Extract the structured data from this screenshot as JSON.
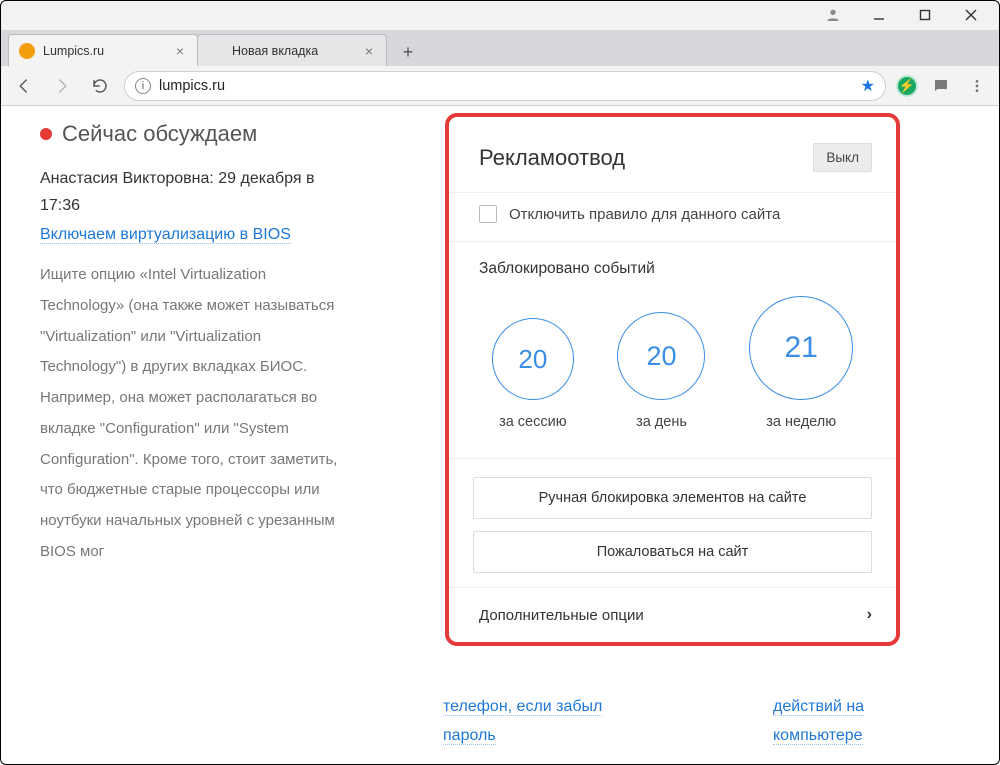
{
  "titlebar": {},
  "tabs": [
    {
      "title": "Lumpics.ru",
      "active": true
    },
    {
      "title": "Новая вкладка",
      "active": false
    }
  ],
  "address": {
    "url": "lumpics.ru"
  },
  "sidebar": {
    "heading": "Сейчас обсуждаем",
    "author_line": "Анастасия Викторовна: 29 декабря в 17:36",
    "link_text": "Включаем виртуализацию в BIOS",
    "body": "Ищите опцию «Intel Virtualization Technology» (она также может называться \"Virtualization\" или \"Virtualization Technology\") в других вкладках БИОС. Например, она может располагаться во вкладке \"Configuration\" или \"System Configuration\". Кроме того, стоит заметить, что бюджетные старые процессоры или ноутбуки начальных уровней с урезанным BIOS мог"
  },
  "bg": {
    "left_line1": "телефон, если забыл",
    "left_line2": "пароль",
    "right_line1": "действий на",
    "right_line2": "компьютере"
  },
  "popup": {
    "title": "Рекламоотвод",
    "off_button": "Выкл",
    "disable_rule": "Отключить правило для данного сайта",
    "blocked_title": "Заблокировано событий",
    "stats": [
      {
        "value": "20",
        "label": "за сессию"
      },
      {
        "value": "20",
        "label": "за день"
      },
      {
        "value": "21",
        "label": "за неделю"
      }
    ],
    "manual_block": "Ручная блокировка элементов на сайте",
    "report": "Пожаловаться на сайт",
    "more": "Дополнительные опции"
  }
}
